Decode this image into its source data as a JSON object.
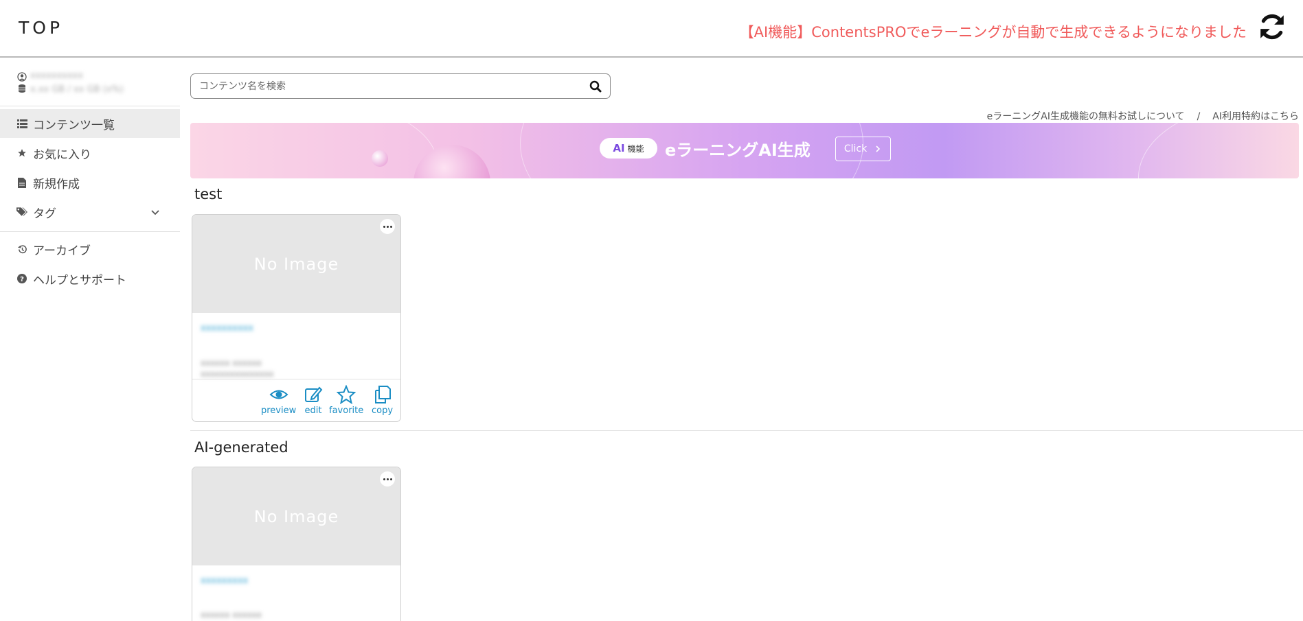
{
  "header": {
    "title": "TOP",
    "notice": "【AI機能】ContentsPROでeラーニングが自動で生成できるようになりました"
  },
  "user": {
    "name": "xxxxxxxxxx",
    "storage": "x.xx GB / xx GB (x%)"
  },
  "sidebar": {
    "items": [
      {
        "label": "コンテンツ一覧",
        "icon": "list-icon"
      },
      {
        "label": "お気に入り",
        "icon": "star-icon"
      },
      {
        "label": "新規作成",
        "icon": "document-icon"
      },
      {
        "label": "タグ",
        "icon": "tags-icon"
      },
      {
        "label": "アーカイブ",
        "icon": "history-icon"
      },
      {
        "label": "ヘルプとサポート",
        "icon": "question-icon"
      }
    ]
  },
  "search": {
    "placeholder": "コンテンツ名を検索"
  },
  "links": {
    "trial": "eラーニングAI生成機能の無料お試しについて",
    "separator": "/",
    "terms": "AI利用特約はこちら"
  },
  "banner": {
    "pill_ai": "AI",
    "pill_label": "機能",
    "title": "eラーニングAI生成",
    "click": "Click"
  },
  "sections": [
    {
      "title": "test",
      "card": {
        "thumb": "No Image",
        "name": "xxxxxxxxxx",
        "meta1": "xxxxxx xxxxxx",
        "meta2": "xxxxxxxxxxxxxxx",
        "actions": [
          "preview",
          "edit",
          "favorite",
          "copy"
        ]
      }
    },
    {
      "title": "AI-generated",
      "card": {
        "thumb": "No Image",
        "name": "xxxxxxxxx",
        "meta1": "xxxxxx xxxxxx"
      }
    }
  ],
  "colors": {
    "notice": "#f05a5a",
    "link_blue": "#1a8dc4",
    "active_bg": "#ececec"
  }
}
